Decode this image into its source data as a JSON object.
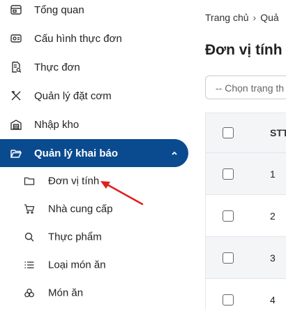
{
  "sidebar": {
    "items": [
      {
        "label": "Tổng quan",
        "icon": "dashboard-icon"
      },
      {
        "label": "Cấu hình thực đơn",
        "icon": "menu-config-icon"
      },
      {
        "label": "Thực đơn",
        "icon": "document-search-icon"
      },
      {
        "label": "Quản lý đặt cơm",
        "icon": "utensils-icon"
      },
      {
        "label": "Nhập kho",
        "icon": "warehouse-icon"
      },
      {
        "label": "Quản lý khai báo",
        "icon": "folder-open-icon",
        "active": true,
        "expanded": true
      }
    ],
    "subitems": [
      {
        "label": "Đơn vị tính",
        "icon": "folder-icon"
      },
      {
        "label": "Nhà cung cấp",
        "icon": "cart-icon"
      },
      {
        "label": "Thực phẩm",
        "icon": "search-icon"
      },
      {
        "label": "Loại món ăn",
        "icon": "list-icon"
      },
      {
        "label": "Món ăn",
        "icon": "dish-icon"
      }
    ]
  },
  "breadcrumb": {
    "home": "Trang chủ",
    "current": "Quả"
  },
  "page": {
    "title": "Đơn vị tính"
  },
  "filter": {
    "placeholder": "-- Chọn trạng th"
  },
  "table": {
    "header": {
      "stt": "STT"
    },
    "rows": [
      "1",
      "2",
      "3",
      "4"
    ]
  },
  "colors": {
    "accent": "#0a4a8f",
    "arrow": "#e0201c"
  }
}
